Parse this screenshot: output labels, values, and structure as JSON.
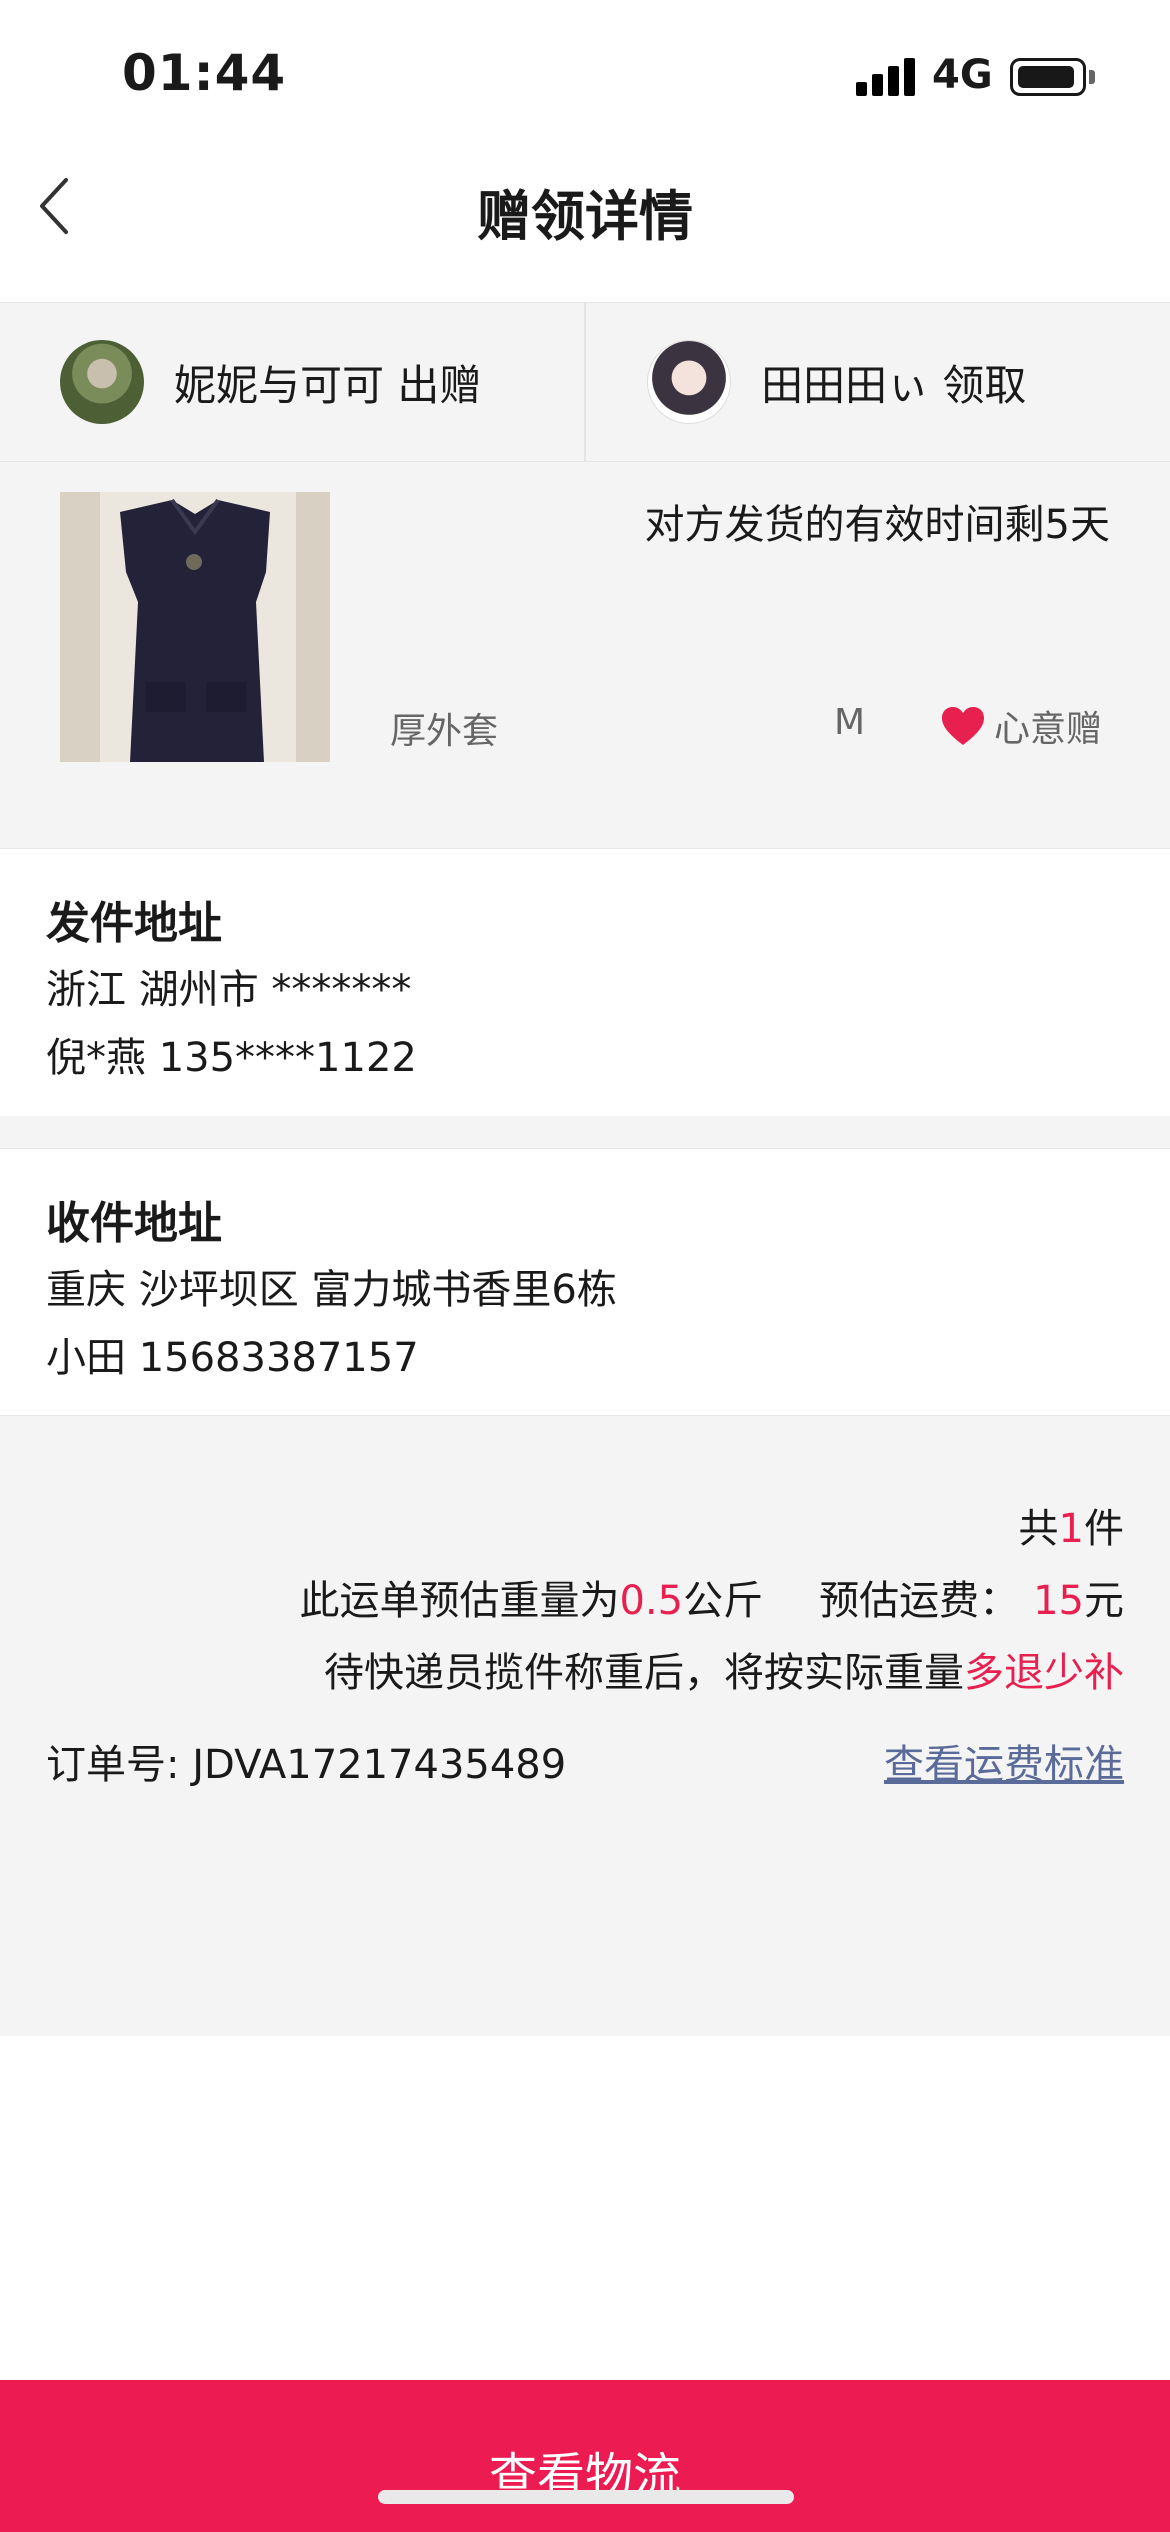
{
  "status": {
    "time": "01:44",
    "network": "4G"
  },
  "nav": {
    "title": "赠领详情"
  },
  "giver": {
    "name_action": "妮妮与可可 出赠"
  },
  "receiver": {
    "name_action": "田田田ぃ 领取"
  },
  "item": {
    "deadline": "对方发货的有效时间剩5天",
    "name": "厚外套",
    "size": "M",
    "gift_label": "心意赠"
  },
  "sender_address": {
    "title": "发件地址",
    "region": "浙江 湖州市 *******",
    "contact": "倪*燕 135****1122"
  },
  "receiver_address": {
    "title": "收件地址",
    "region": "重庆 沙坪坝区 富力城书香里6栋",
    "contact": "小田 15683387157"
  },
  "shipping": {
    "count_prefix": "共",
    "count": "1",
    "count_suffix": "件",
    "weight_prefix": "此运单预估重量为",
    "weight": "0.5",
    "weight_unit": "公斤",
    "fee_label": "预估运费：",
    "fee": "15",
    "fee_unit": "元",
    "note_prefix": "待快递员揽件称重后，将按实际重量",
    "note_highlight": "多退少补",
    "order_label": "订单号: JDVA17217435489",
    "fee_standard_link": "查看运费标准"
  },
  "bottom_button": {
    "label": "查看物流"
  },
  "colors": {
    "accent": "#ec1c52",
    "highlight": "#e8204f",
    "link": "#5a6b99",
    "background": "#f4f4f4"
  }
}
